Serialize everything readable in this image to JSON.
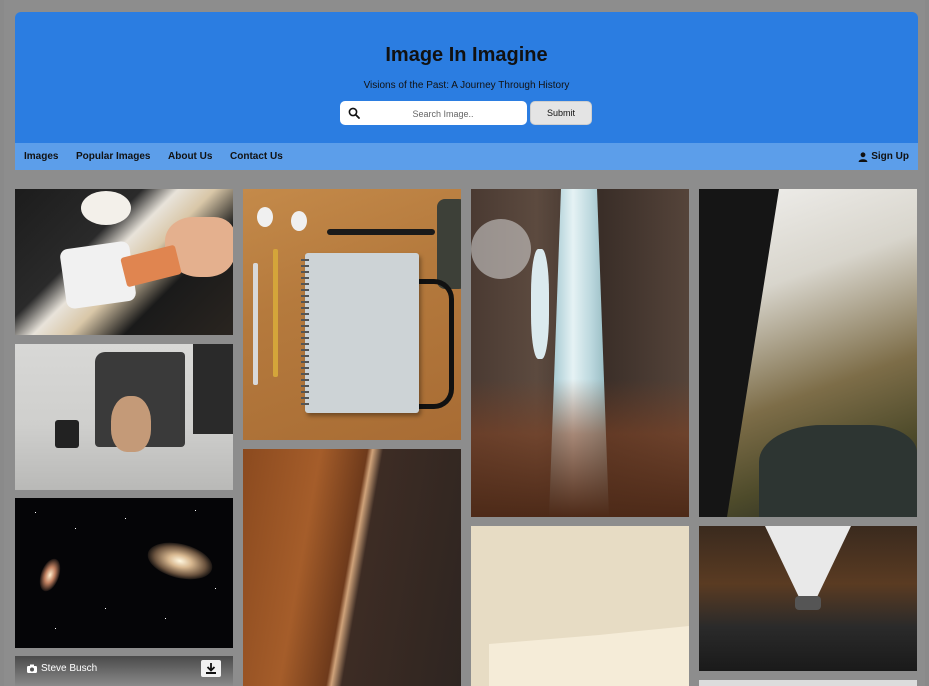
{
  "header": {
    "title": "Image In Imagine",
    "subtitle": "Visions of the Past: A Journey Through History",
    "search_placeholder": "Search Image..",
    "submit_label": "Submit"
  },
  "nav": {
    "items": [
      "Images",
      "Popular Images",
      "About Us",
      "Contact Us"
    ],
    "signup_label": "Sign Up"
  },
  "gallery": {
    "credit_name": "Steve Busch",
    "icons": {
      "search": "search-icon",
      "user": "user-icon",
      "camera": "camera-icon",
      "download": "download-icon"
    }
  },
  "colors": {
    "header_bg": "#2b7de1",
    "nav_bg": "#5c9eea",
    "page_bg": "#8d8d8d"
  }
}
